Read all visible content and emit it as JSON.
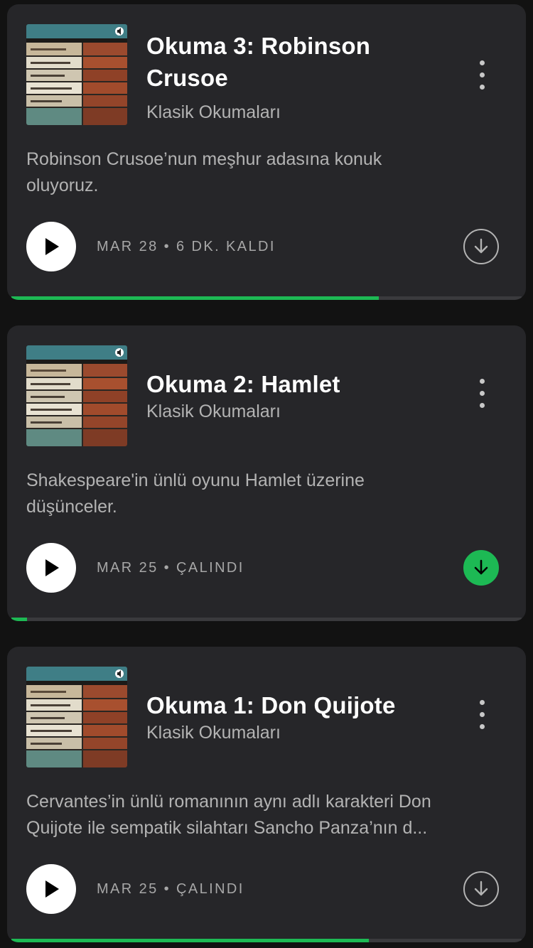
{
  "episodes": [
    {
      "title": "Okuma 3: Robinson Crusoe",
      "show": "Klasik Okumaları",
      "description_lines": [
        "Robinson Crusoe’nun meşhur adasına konuk",
        "oluyoruz."
      ],
      "date": "MAR 28",
      "separator": "•",
      "status": "6 DK. KALDI",
      "downloaded": false,
      "progress": 0.72
    },
    {
      "title": "Okuma 2: Hamlet",
      "show": "Klasik Okumaları",
      "description_lines": [
        "Shakespeare'in ünlü oyunu Hamlet üzerine",
        "düşünceler."
      ],
      "date": "MAR 25",
      "separator": "•",
      "status": "ÇALINDI",
      "downloaded": true,
      "progress": 0.03
    },
    {
      "title": "Okuma 1: Don Quijote",
      "show": "Klasik Okumaları",
      "description_lines": [
        "Cervantes’in ünlü romanının aynı adlı karakteri Don",
        "Quijote ile sempatik silahtarı Sancho Panza’nın d..."
      ],
      "date": "MAR 25",
      "separator": "•",
      "status": "ÇALINDI",
      "downloaded": false,
      "progress": 0.7
    }
  ],
  "icons": {
    "cover": "book-stack-cover-icon",
    "play": "play-icon",
    "more": "more-options-icon",
    "download": "download-arrow-icon"
  },
  "colors": {
    "background": "#121212",
    "card": "#262629",
    "accent_green": "#1db954",
    "text_primary": "#ffffff",
    "text_secondary": "#b3b3b3"
  }
}
